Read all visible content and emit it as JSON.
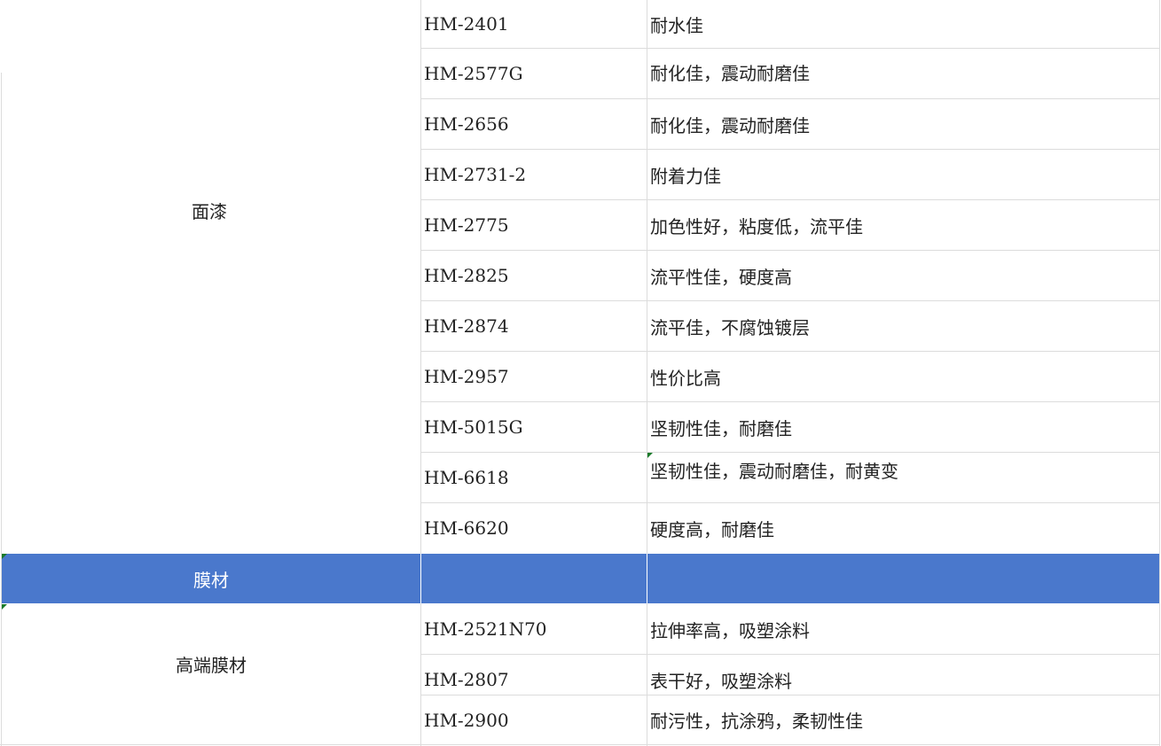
{
  "groups": {
    "topcoat": "面漆",
    "film": "膜材",
    "highend_film": "高端膜材"
  },
  "topcoat_rows": [
    {
      "code": "HM-2401",
      "desc": "耐水佳"
    },
    {
      "code": "HM-2577G",
      "desc": "耐化佳，震动耐磨佳"
    },
    {
      "code": "HM-2656",
      "desc": "耐化佳，震动耐磨佳"
    },
    {
      "code": "HM-2731-2",
      "desc": "附着力佳"
    },
    {
      "code": "HM-2775",
      "desc": "加色性好，粘度低，流平佳"
    },
    {
      "code": "HM-2825",
      "desc": "流平性佳，硬度高"
    },
    {
      "code": "HM-2874",
      "desc": "流平佳，不腐蚀镀层"
    },
    {
      "code": "HM-2957",
      "desc": "性价比高"
    },
    {
      "code": "HM-5015G",
      "desc": "坚韧性佳，耐磨佳"
    },
    {
      "code": "HM-6618",
      "desc": "坚韧性佳，震动耐磨佳，耐黄变"
    },
    {
      "code": "HM-6620",
      "desc": "硬度高，耐磨佳"
    }
  ],
  "film_rows": [
    {
      "code": "HM-2521N70",
      "desc": "拉伸率高，吸塑涂料"
    },
    {
      "code": "HM-2807",
      "desc": "表干好，吸塑涂料"
    },
    {
      "code": "HM-2900",
      "desc": "耐污性，抗涂鸦，柔韧性佳"
    }
  ],
  "colors": {
    "band": "#4a78cc",
    "band_text": "#ffffff",
    "grid": "#dcdcdc",
    "comment_marker": "#1a7a2a"
  }
}
